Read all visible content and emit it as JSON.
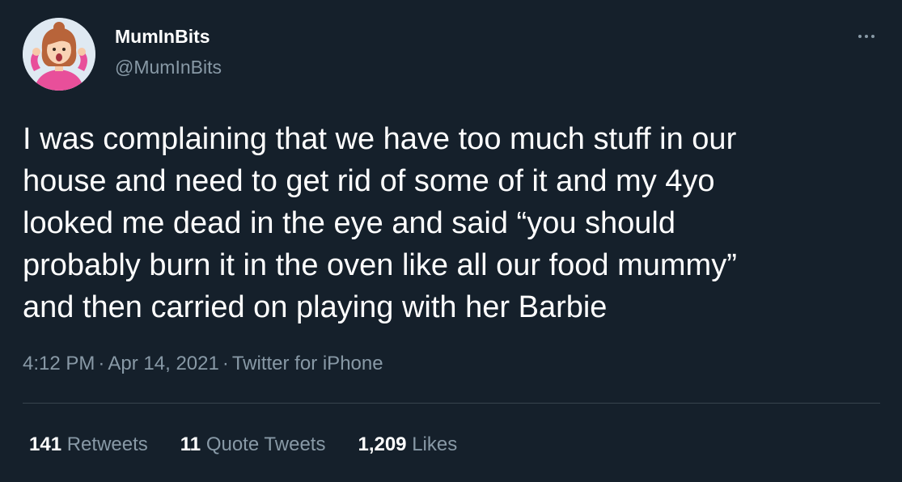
{
  "author": {
    "display_name": "MumInBits",
    "handle": "@MumInBits",
    "avatar_icon": "cartoon-mum-avatar"
  },
  "tweet": {
    "text": "I was complaining that we have too much stuff in our\nhouse and need to get rid of some of it and my 4yo\nlooked me dead in the eye and said “you should\nprobably burn it in the oven like all our food mummy”\nand then carried on playing with her Barbie",
    "time": "4:12 PM",
    "separator": "·",
    "date": "Apr 14, 2021",
    "source": "Twitter for iPhone"
  },
  "stats": {
    "retweets_count": "141",
    "retweets_label": "Retweets",
    "quote_tweets_count": "11",
    "quote_tweets_label": "Quote Tweets",
    "likes_count": "1,209",
    "likes_label": "Likes"
  },
  "icons": {
    "more_menu": "more-horizontal-icon"
  },
  "colors": {
    "background": "#15202b",
    "primary_text": "#ffffff",
    "secondary_text": "#8899a6",
    "divider": "#38444d"
  }
}
